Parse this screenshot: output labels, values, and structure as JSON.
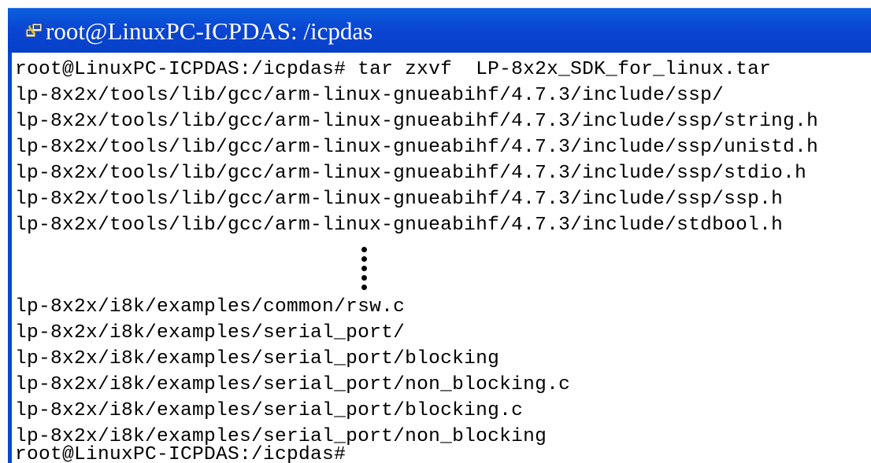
{
  "window": {
    "title": "root@LinuxPC-ICPDAS: /icpdas",
    "title_bar_color": "#0a46d2"
  },
  "terminal": {
    "top_lines": [
      "root@LinuxPC-ICPDAS:/icpdas# tar zxvf  LP-8x2x_SDK_for_linux.tar",
      "lp-8x2x/tools/lib/gcc/arm-linux-gnueabihf/4.7.3/include/ssp/",
      "lp-8x2x/tools/lib/gcc/arm-linux-gnueabihf/4.7.3/include/ssp/string.h",
      "lp-8x2x/tools/lib/gcc/arm-linux-gnueabihf/4.7.3/include/ssp/unistd.h",
      "lp-8x2x/tools/lib/gcc/arm-linux-gnueabihf/4.7.3/include/ssp/stdio.h",
      "lp-8x2x/tools/lib/gcc/arm-linux-gnueabihf/4.7.3/include/ssp/ssp.h",
      "lp-8x2x/tools/lib/gcc/arm-linux-gnueabihf/4.7.3/include/stdbool.h"
    ],
    "bottom_lines": [
      "lp-8x2x/i8k/examples/common/rsw.c",
      "lp-8x2x/i8k/examples/serial_port/",
      "lp-8x2x/i8k/examples/serial_port/blocking",
      "lp-8x2x/i8k/examples/serial_port/non_blocking.c",
      "lp-8x2x/i8k/examples/serial_port/blocking.c",
      "lp-8x2x/i8k/examples/serial_port/non_blocking",
      "root@LinuxPC-ICPDAS:/icpdas#"
    ]
  }
}
